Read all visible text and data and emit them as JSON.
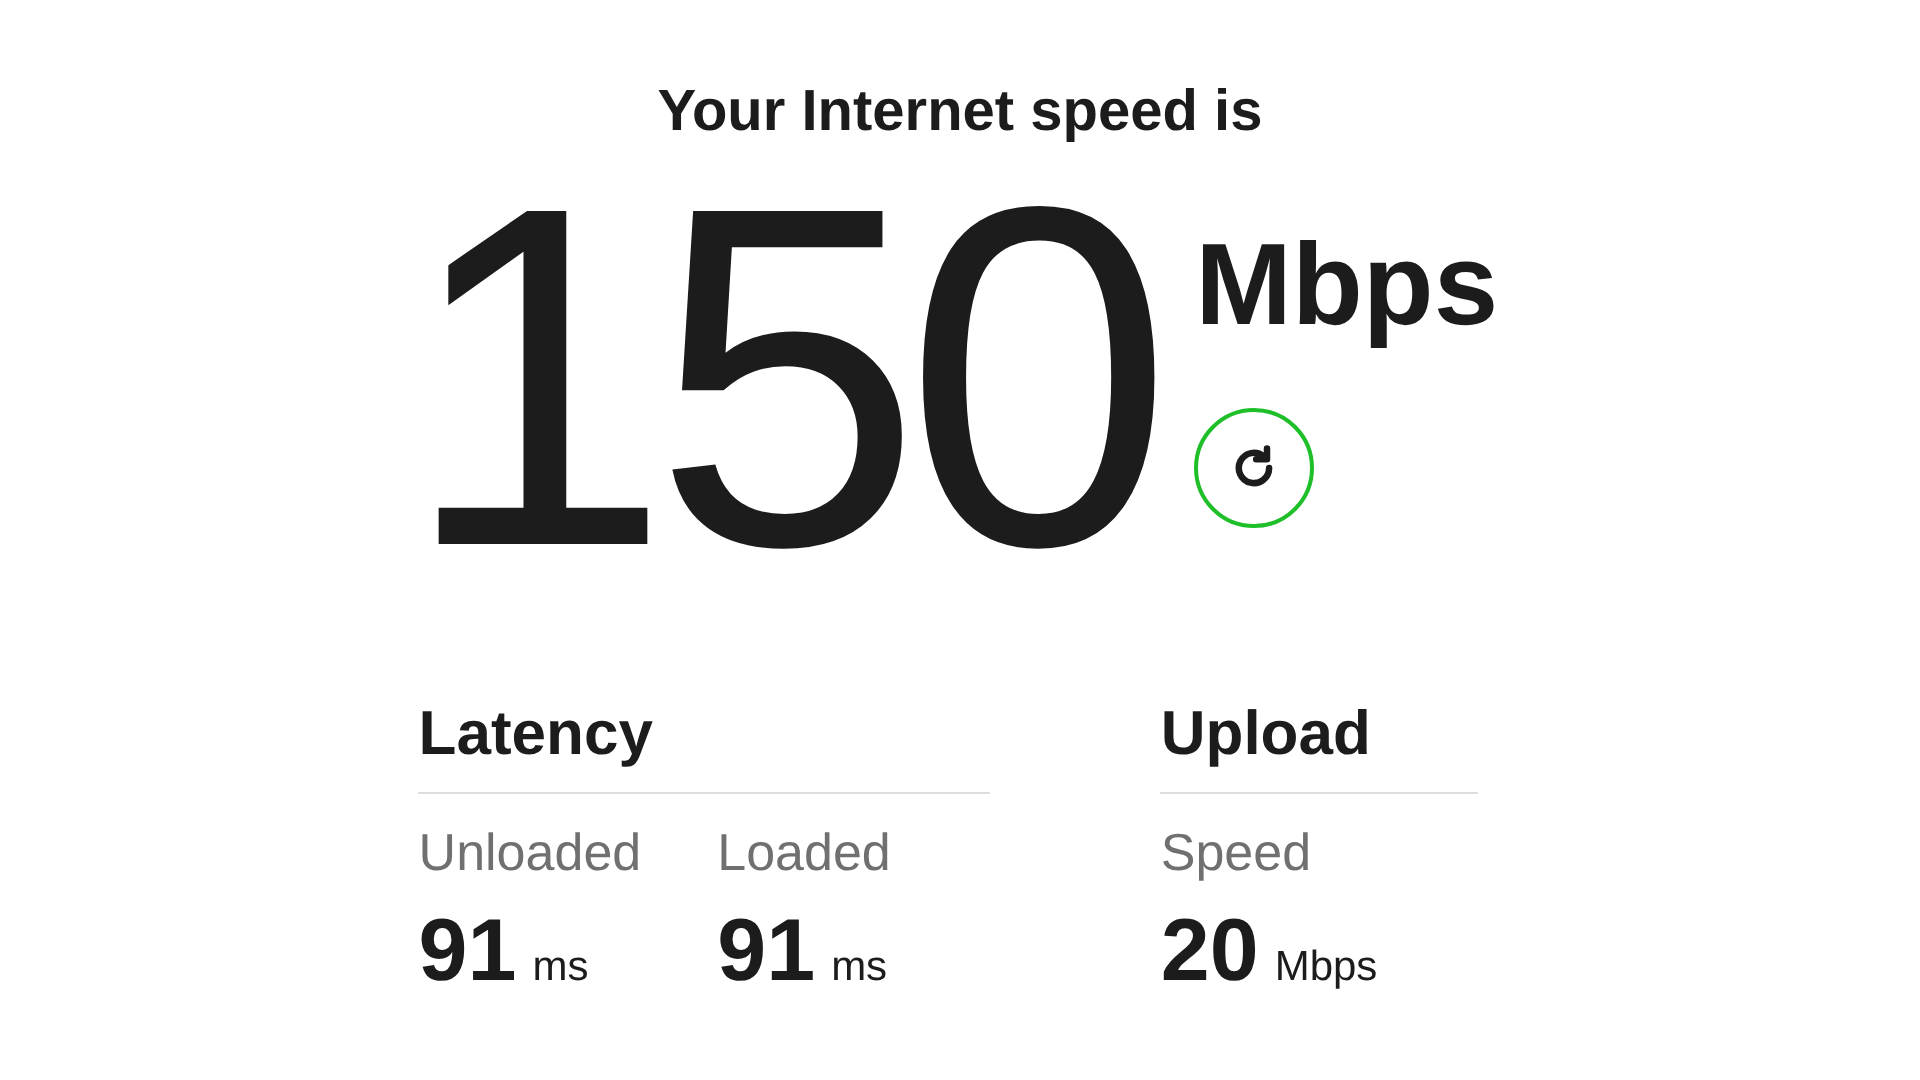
{
  "title": "Your Internet speed is",
  "speed": {
    "value": "150",
    "unit": "Mbps"
  },
  "sections": [
    {
      "heading": "Latency",
      "metrics": [
        {
          "label": "Unloaded",
          "value": "91",
          "unit": "ms"
        },
        {
          "label": "Loaded",
          "value": "91",
          "unit": "ms"
        }
      ]
    },
    {
      "heading": "Upload",
      "metrics": [
        {
          "label": "Speed",
          "value": "20",
          "unit": "Mbps"
        }
      ]
    }
  ]
}
